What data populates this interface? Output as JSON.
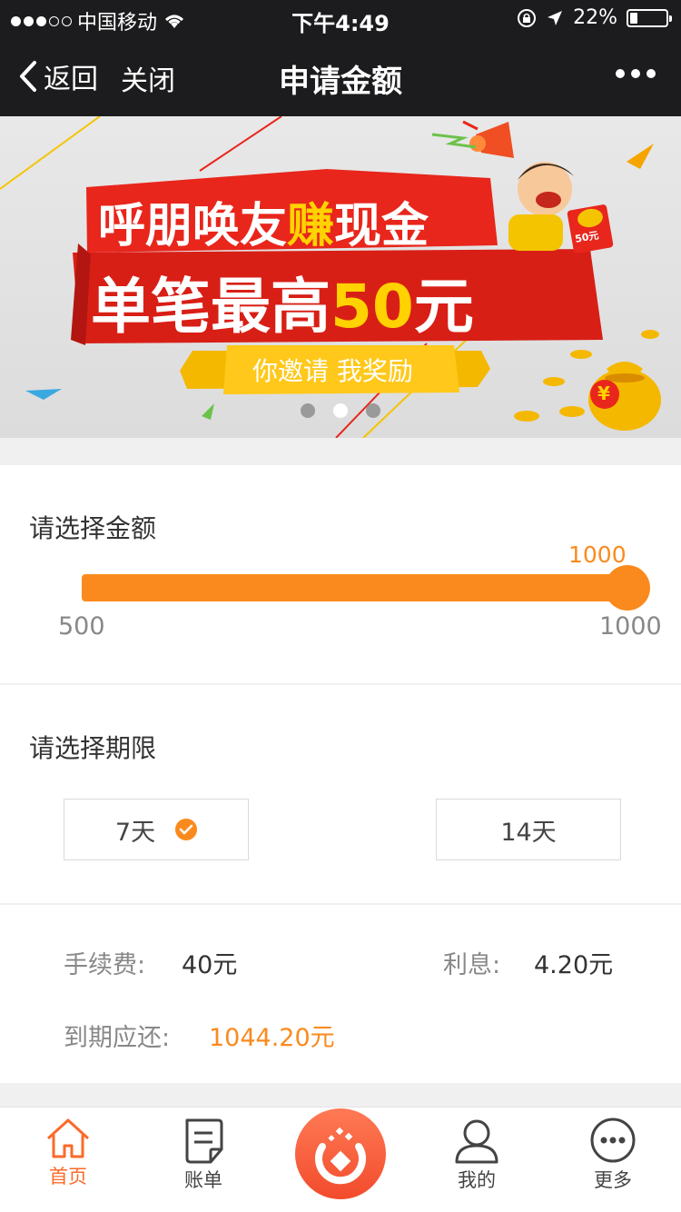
{
  "status_bar": {
    "carrier": "中国移动",
    "time": "下午4:49",
    "battery_percent": "22%",
    "battery_level": 0.22
  },
  "nav": {
    "back_label": "返回",
    "close_label": "关闭",
    "title": "申请金额"
  },
  "banner": {
    "line1_part1": "呼朋唤友",
    "line1_highlight": "赚",
    "line1_part2": "现金",
    "line2_part1": "单笔最高",
    "line2_highlight": "50",
    "line2_part2": "元",
    "ribbon_text": "你邀请 我奖励",
    "badge_text": "50元",
    "yuan_symbol": "¥",
    "slides_total": 3,
    "active_slide": 2
  },
  "amount": {
    "title": "请选择金额",
    "current": "1000",
    "min_label": "500",
    "max_label": "1000",
    "min": 500,
    "max": 1000,
    "value": 1000
  },
  "period": {
    "title": "请选择期限",
    "options": [
      {
        "label": "7天",
        "selected": true
      },
      {
        "label": "14天",
        "selected": false
      }
    ]
  },
  "fees": {
    "fee_label": "手续费:",
    "fee_value": "40元",
    "interest_label": "利息:",
    "interest_value": "4.20元",
    "due_label": "到期应还:",
    "due_value": "1044.20元"
  },
  "tabbar": {
    "items": [
      {
        "label": "首页",
        "icon": "home-icon",
        "active": true
      },
      {
        "label": "账单",
        "icon": "bill-icon",
        "active": false
      },
      {
        "label": "",
        "icon": "apply-center-icon",
        "active": false
      },
      {
        "label": "我的",
        "icon": "user-icon",
        "active": false
      },
      {
        "label": "更多",
        "icon": "more-icon",
        "active": false
      }
    ]
  },
  "colors": {
    "accent": "#fb8a1e",
    "nav_bg": "#1c1c1e",
    "tab_active": "#fb6a2a",
    "banner_red": "#e8261c",
    "banner_yellow": "#ffd200"
  }
}
